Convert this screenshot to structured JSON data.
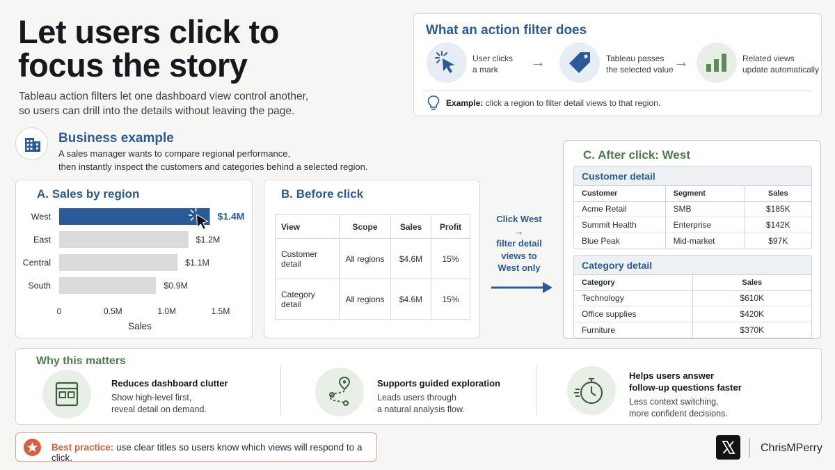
{
  "header": {
    "title_line1": "Let users click to",
    "title_line2": "focus the story",
    "subtitle_line1": "Tableau action filters let one dashboard view control another,",
    "subtitle_line2": "so users can drill into the details without leaving the page."
  },
  "action_filter": {
    "heading": "What an action filter does",
    "steps": [
      {
        "icon": "cursor-click-icon",
        "line1": "User clicks",
        "line2": "a mark"
      },
      {
        "icon": "tag-icon",
        "line1": "Tableau passes",
        "line2": "the selected value"
      },
      {
        "icon": "bar-chart-icon",
        "line1": "Related views",
        "line2": "update automatically"
      }
    ],
    "example_label": "Example:",
    "example_text": " click a region to filter detail views to that region."
  },
  "business": {
    "heading": "Business example",
    "line1": "A sales manager wants to compare regional performance,",
    "line2": "then instantly inspect the customers and categories behind a selected region."
  },
  "panel_a": {
    "title": "A.  Sales by region"
  },
  "chart_data": {
    "type": "bar",
    "orientation": "horizontal",
    "categories": [
      "West",
      "East",
      "Central",
      "South"
    ],
    "values": [
      1.4,
      1.2,
      1.1,
      0.9
    ],
    "value_labels": [
      "$1.4M",
      "$1.2M",
      "$1.1M",
      "$0.9M"
    ],
    "highlighted": "West",
    "xlabel": "Sales",
    "xticks": [
      "0",
      "0.5M",
      "1.0M",
      "1.5M"
    ],
    "xlim": [
      0,
      1.5
    ],
    "colors": {
      "highlight": "#2a5a97",
      "default": "#d9dbdd"
    }
  },
  "panel_b": {
    "title": "B.  Before click",
    "headers": [
      "View",
      "Scope",
      "Sales",
      "Profit"
    ],
    "rows": [
      [
        "Customer detail",
        "All regions",
        "$4.6M",
        "15%"
      ],
      [
        "Category detail",
        "All regions",
        "$4.6M",
        "15%"
      ]
    ]
  },
  "transition": {
    "line1": "Click West",
    "line2": "→",
    "line3": "filter detail",
    "line4": "views to",
    "line5": "West only"
  },
  "panel_c": {
    "title": "C.  After click: West",
    "customer": {
      "heading": "Customer detail",
      "headers": [
        "Customer",
        "Segment",
        "Sales"
      ],
      "rows": [
        [
          "Acme Retail",
          "SMB",
          "$185K"
        ],
        [
          "Summit Health",
          "Enterprise",
          "$142K"
        ],
        [
          "Blue Peak",
          "Mid-market",
          "$97K"
        ]
      ]
    },
    "category": {
      "heading": "Category detail",
      "headers": [
        "Category",
        "Sales"
      ],
      "rows": [
        [
          "Technology",
          "$610K"
        ],
        [
          "Office supplies",
          "$420K"
        ],
        [
          "Furniture",
          "$370K"
        ]
      ]
    }
  },
  "why": {
    "heading": "Why this matters",
    "items": [
      {
        "icon": "layout-icon",
        "title_line1": "Reduces dashboard clutter",
        "title_line2": "",
        "line1": "Show high-level first,",
        "line2": "reveal detail on demand."
      },
      {
        "icon": "route-pin-icon",
        "title_line1": "Supports guided exploration",
        "title_line2": "",
        "line1": "Leads users through",
        "line2": "a natural analysis flow."
      },
      {
        "icon": "stopwatch-icon",
        "title_line1": "Helps users answer",
        "title_line2": "follow-up questions faster",
        "line1": "Less context switching,",
        "line2": "more confident decisions."
      }
    ]
  },
  "best_practice": {
    "label": "Best practice:",
    "text": " use clear titles so users know which views will respond to a click."
  },
  "brand": {
    "name": "ChrisMPerry"
  },
  "colors": {
    "primary_blue": "#2a5a97",
    "accent_green": "#4e7a4b",
    "accent_orange": "#d8603f"
  }
}
